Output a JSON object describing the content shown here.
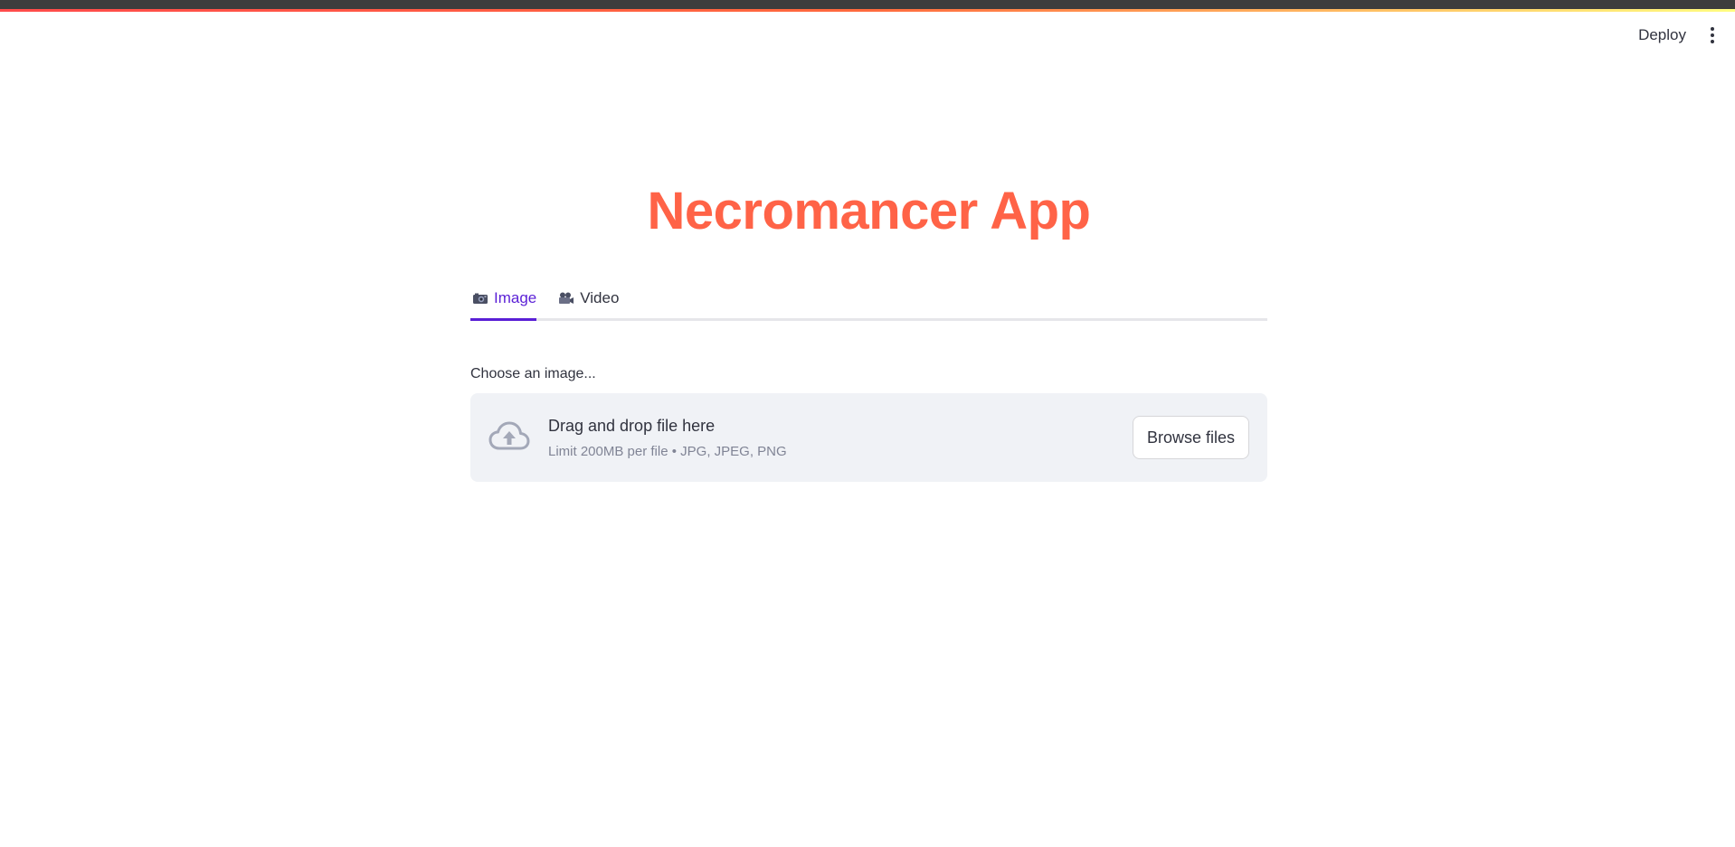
{
  "header": {
    "deploy_label": "Deploy",
    "menu_icon": "kebab-menu-icon"
  },
  "app": {
    "title": "Necromancer App",
    "title_color": "#ff6347",
    "accent_color": "#5a1fd6"
  },
  "tabs": [
    {
      "icon": "camera-icon",
      "label": "Image",
      "active": true
    },
    {
      "icon": "movie-camera-icon",
      "label": "Video",
      "active": false
    }
  ],
  "uploader": {
    "label": "Choose an image...",
    "icon": "cloud-upload-icon",
    "title": "Drag and drop file here",
    "subtitle": "Limit 200MB per file • JPG, JPEG, PNG",
    "button_label": "Browse files"
  }
}
